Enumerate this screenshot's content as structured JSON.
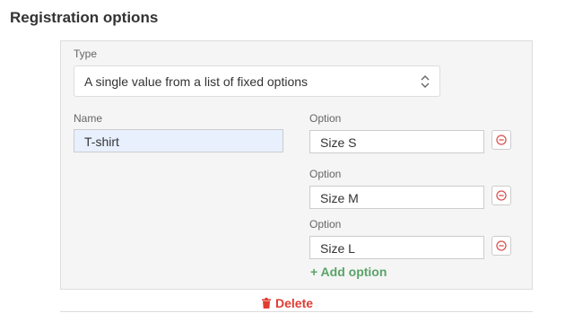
{
  "section": {
    "title": "Registration options"
  },
  "type_field": {
    "label": "Type",
    "value": "A single value from a list of fixed options",
    "icon": "chevron-up-down-icon"
  },
  "name_field": {
    "label": "Name",
    "value": "T-shirt"
  },
  "options": [
    {
      "label": "Option",
      "value": "Size S",
      "remove_icon": "minus-circle-icon"
    },
    {
      "label": "Option",
      "value": "Size M",
      "remove_icon": "minus-circle-icon"
    },
    {
      "label": "Option",
      "value": "Size L",
      "remove_icon": "minus-circle-icon"
    }
  ],
  "actions": {
    "add_option": "+ Add option",
    "delete": "Delete",
    "delete_icon": "trash-icon"
  },
  "colors": {
    "add": "#5aa469",
    "delete": "#e03c31",
    "remove_icon": "#d9534f",
    "name_input_bg": "#e8f0fe"
  }
}
